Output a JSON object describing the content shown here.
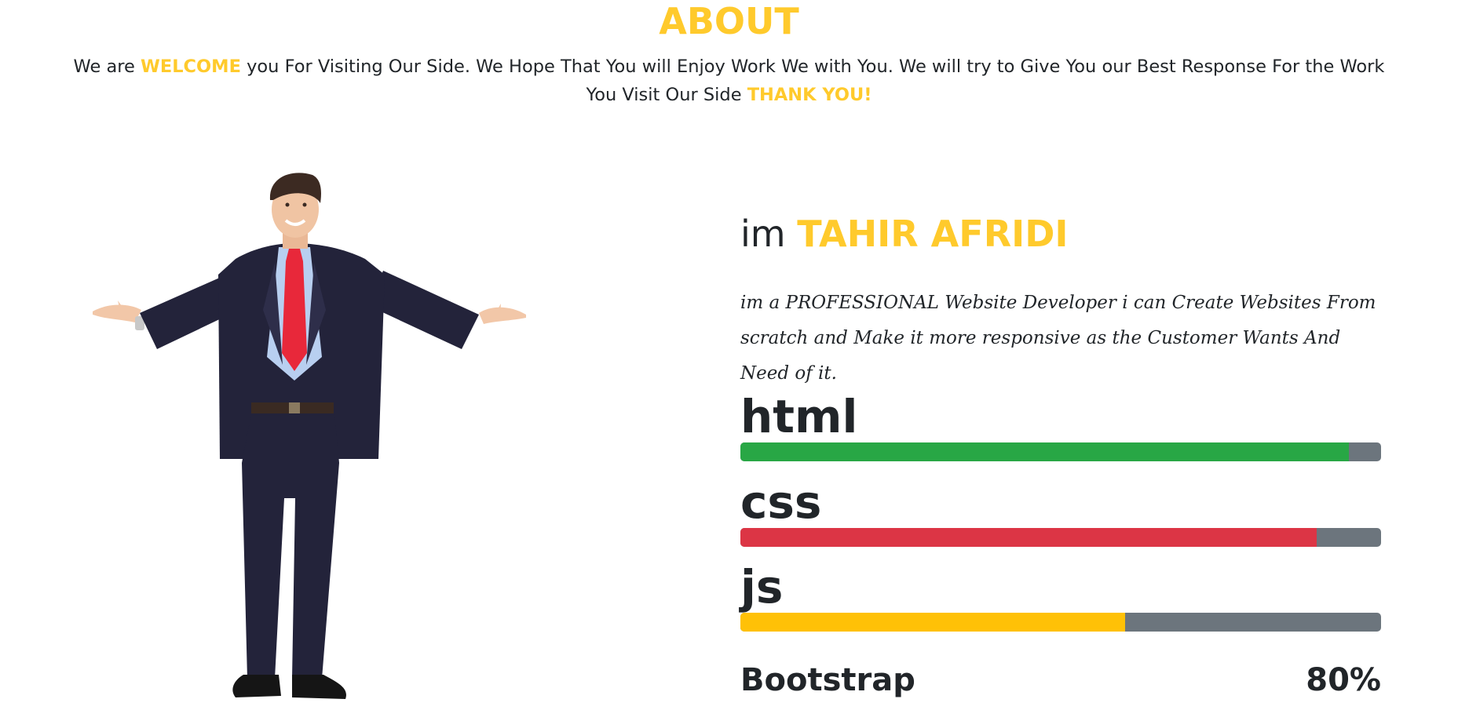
{
  "about": {
    "title": "ABOUT",
    "intro_start": "We are ",
    "intro_welcome": "WELCOME",
    "intro_middle": " you For Visiting Our Side. We Hope That You will Enjoy Work We with You. We will try to Give You our Best Response For the Work You Visit Our Side ",
    "intro_thanks": "THANK YOU!"
  },
  "profile": {
    "name_prefix": "im ",
    "name": "TAHIR AFRIDI",
    "bio": "im a PROFESSIONAL Website Developer i can Create Websites From scratch and Make it more responsive as the Customer Wants And Need of it.",
    "image": "businessman-open-arms-photo"
  },
  "skills": [
    {
      "label": "html",
      "percent": 95,
      "color": "#28a745"
    },
    {
      "label": "css",
      "percent": 90,
      "color": "#dc3545"
    },
    {
      "label": "js",
      "percent": 60,
      "color": "#ffc107"
    }
  ],
  "bootstrap": {
    "label": "Bootstrap",
    "value": "80%"
  },
  "colors": {
    "accent": "#ffca2c",
    "text": "#212529",
    "track": "#6c757d"
  }
}
